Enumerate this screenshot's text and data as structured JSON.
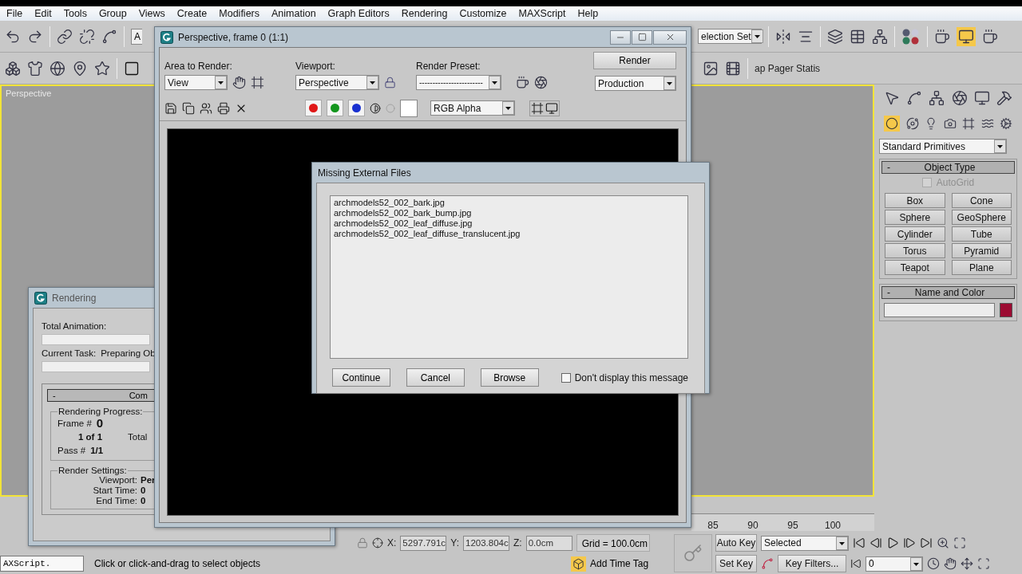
{
  "menu": [
    "File",
    "Edit",
    "Tools",
    "Group",
    "Views",
    "Create",
    "Modifiers",
    "Animation",
    "Graph Editors",
    "Rendering",
    "Customize",
    "MAXScript",
    "Help"
  ],
  "main_toolbar": {
    "field": "A",
    "selection_set": "election Set"
  },
  "render_toolbar": {
    "label": "ap Pager Statis"
  },
  "viewport": {
    "label": "Perspective",
    "active": true
  },
  "command_panel": {
    "category": "Standard Primitives",
    "rollouts": [
      {
        "kind": "object_type",
        "toggle": "-",
        "title": "Object Type",
        "autogrid": {
          "label": "AutoGrid",
          "checked": false,
          "disabled": true
        },
        "buttons": [
          "Box",
          "Cone",
          "Sphere",
          "GeoSphere",
          "Cylinder",
          "Tube",
          "Torus",
          "Pyramid",
          "Teapot",
          "Plane"
        ]
      },
      {
        "kind": "name_color",
        "toggle": "-",
        "title": "Name and Color",
        "color": "#9c0b32"
      }
    ]
  },
  "time_slider": {
    "ticks": [
      "85",
      "90",
      "95",
      "100"
    ]
  },
  "status": {
    "maxscript": "AXScript.",
    "prompt": "Click or click-and-drag to select objects",
    "coords": [
      {
        "label": "X:",
        "value": "5297.791c"
      },
      {
        "label": "Y:",
        "value": "1203.804c"
      },
      {
        "label": "Z:",
        "value": "0.0cm"
      }
    ],
    "grid": "Grid = 100.0cm",
    "time_tag": "Add Time Tag",
    "auto_key": "Auto Key",
    "key_mode": "Selected",
    "set_key": "Set Key",
    "key_filters": "Key Filters...",
    "frame": "0"
  },
  "rendering_dialog": {
    "title": "Rendering",
    "total_animation": "Total Animation:",
    "current_task_label": "Current Task:",
    "current_task": "Preparing Ob",
    "progress": [
      {
        "level": 0
      },
      {
        "level": 0
      }
    ],
    "rollout_toggle": "-",
    "rollout_title": "Com",
    "progress_group": "Rendering Progress:",
    "frame_label": "Frame #",
    "frame": "0",
    "count": "1 of 1",
    "total": "Total",
    "pass_label": "Pass #",
    "pass": "1/1",
    "settings_group": "Render Settings:",
    "settings": [
      {
        "label": "Viewport:",
        "value": "Per"
      },
      {
        "label": "Start Time:",
        "value": "0"
      },
      {
        "label": "End Time:",
        "value": "0"
      }
    ]
  },
  "frame_window": {
    "title": "Perspective, frame 0 (1:1)",
    "area_label": "Area to Render:",
    "area": "View",
    "viewport_label": "Viewport:",
    "viewport": "Perspective",
    "preset_label": "Render Preset:",
    "preset": "------------------------",
    "render": "Render",
    "render_mode": "Production",
    "channels": [
      {
        "color": "#e01818"
      },
      {
        "color": "#14961e"
      },
      {
        "color": "#1830d0"
      }
    ],
    "display": "RGB Alpha"
  },
  "missing_files_dialog": {
    "title": "Missing External Files",
    "files": [
      "archmodels52_002_bark.jpg",
      "archmodels52_002_bark_bump.jpg",
      "archmodels52_002_leaf_diffuse.jpg",
      "archmodels52_002_leaf_diffuse_translucent.jpg"
    ],
    "buttons": [
      "Continue",
      "Cancel",
      "Browse"
    ],
    "dont_display": {
      "label": "Don't display this message",
      "checked": false
    }
  }
}
